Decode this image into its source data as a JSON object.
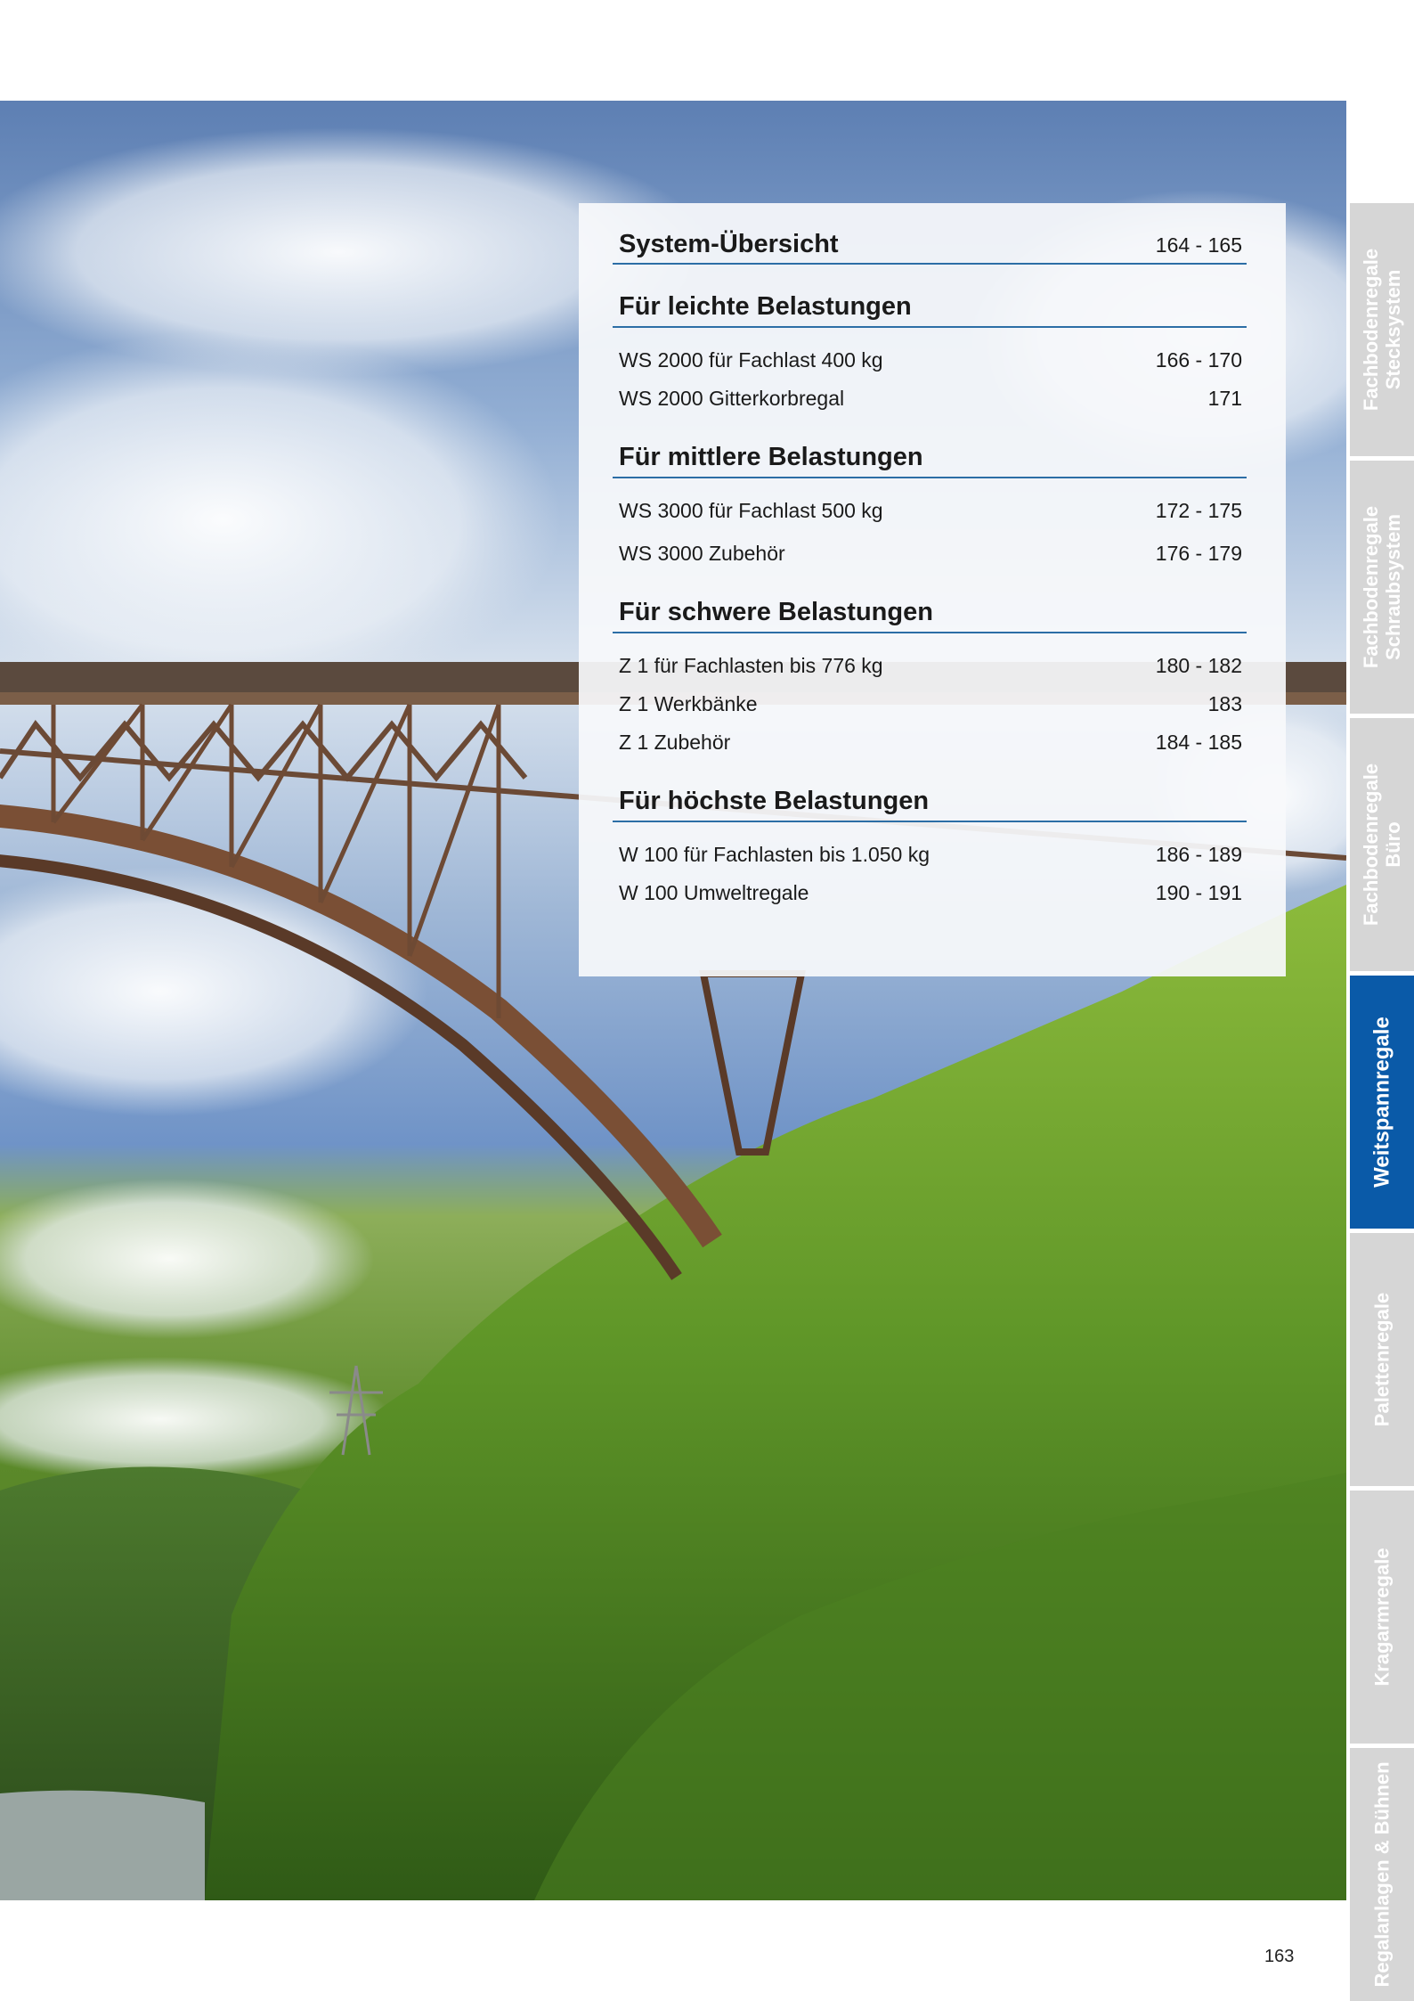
{
  "toc": {
    "overview": {
      "title": "System-Übersicht",
      "pages": "164 - 165"
    },
    "sections": [
      {
        "heading": "Für leichte Belastungen",
        "items": [
          {
            "label": "WS 2000 für Fachlast 400 kg",
            "pages": "166 - 170"
          },
          {
            "label": "WS 2000 Gitterkorbregal",
            "pages": "171"
          }
        ]
      },
      {
        "heading": "Für mittlere Belastungen",
        "items": [
          {
            "label": "WS 3000 für Fachlast 500 kg",
            "pages": "172 - 175"
          },
          {
            "label": "WS 3000 Zubehör",
            "pages": "176 - 179"
          }
        ]
      },
      {
        "heading": "Für schwere Belastungen",
        "items": [
          {
            "label": "Z 1 für Fachlasten bis 776 kg",
            "pages": "180 - 182"
          },
          {
            "label": "Z 1 Werkbänke",
            "pages": "183"
          },
          {
            "label": "Z 1 Zubehör",
            "pages": "184 - 185"
          }
        ]
      },
      {
        "heading": "Für höchste Belastungen",
        "items": [
          {
            "label": "W 100 für Fachlasten bis 1.050 kg",
            "pages": "186 - 189"
          },
          {
            "label": "W 100 Umweltregale",
            "pages": "190 - 191"
          }
        ]
      }
    ]
  },
  "tabs": [
    {
      "line1": "Fachbodenregale",
      "line2": "Stecksystem",
      "active": false
    },
    {
      "line1": "Fachbodenregale",
      "line2": "Schraubsystem",
      "active": false
    },
    {
      "line1": "Fachbodenregale",
      "line2": "Büro",
      "active": false
    },
    {
      "line1": "Weitspannregale",
      "line2": "",
      "active": true
    },
    {
      "line1": "Palettenregale",
      "line2": "",
      "active": false
    },
    {
      "line1": "Kragarmregale",
      "line2": "",
      "active": false
    },
    {
      "line1": "Regalanlagen & Bühnen",
      "line2": "",
      "active": false
    }
  ],
  "colors": {
    "accent": "#0a5aa8",
    "rule": "#2c6ea6",
    "tab_inactive": "#d6d6d6"
  },
  "page_number": "163"
}
